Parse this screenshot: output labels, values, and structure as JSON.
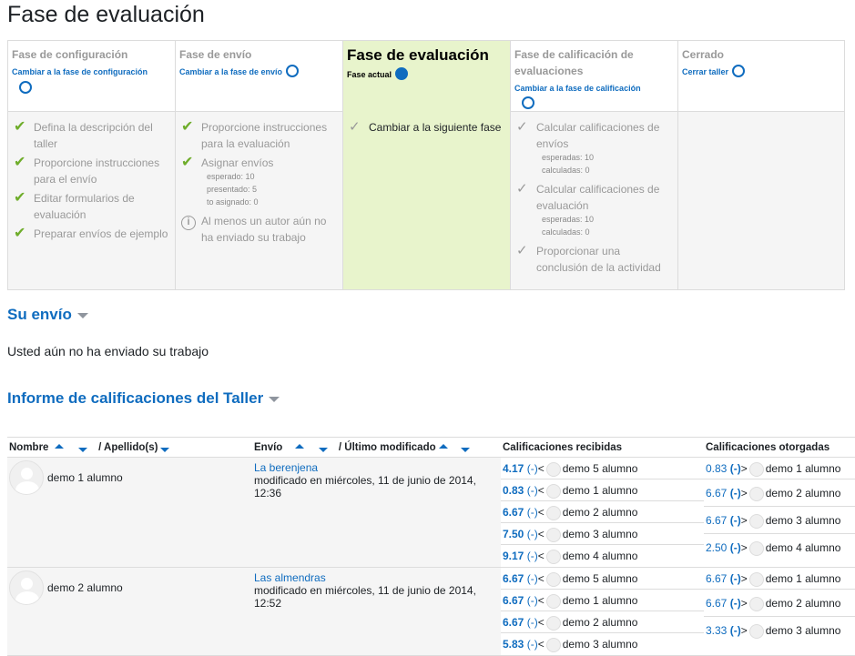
{
  "page_title": "Fase de evaluación",
  "phases": [
    {
      "title": "Fase de configuración",
      "link": "Cambiar a la fase de configuración",
      "tasks": [
        {
          "text": "Defina la descripción del taller",
          "status": "done"
        },
        {
          "text": "Proporcione instrucciones para el envío",
          "status": "done"
        },
        {
          "text": "Editar formularios de evaluación",
          "status": "done"
        },
        {
          "text": "Preparar envíos de ejemplo",
          "status": "done"
        }
      ]
    },
    {
      "title": "Fase de envío",
      "link": "Cambiar a la fase de envío",
      "tasks": [
        {
          "text": "Proporcione instrucciones para la evaluación",
          "status": "done"
        },
        {
          "text": "Asignar envíos",
          "status": "done",
          "details": [
            "esperado: 10",
            "presentado: 5",
            "to asignado: 0"
          ]
        },
        {
          "text": "Al menos un autor aún no ha enviado su trabajo",
          "status": "info"
        }
      ]
    },
    {
      "title": "Fase de evaluación",
      "current_label": "Fase actual",
      "tasks": [
        {
          "text": "Cambiar a la siguiente fase",
          "status": "todo"
        }
      ]
    },
    {
      "title": "Fase de calificación de evaluaciones",
      "link": "Cambiar a la fase de calificación",
      "tasks": [
        {
          "text": "Calcular calificaciones de envíos",
          "status": "todo",
          "details": [
            "esperadas: 10",
            "calculadas: 0"
          ]
        },
        {
          "text": "Calcular calificaciones de evaluación",
          "status": "todo",
          "details": [
            "esperadas: 10",
            "calculadas: 0"
          ]
        },
        {
          "text": "Proporcionar una conclusión de la actividad",
          "status": "todo"
        }
      ]
    },
    {
      "title": "Cerrado",
      "link": "Cerrar taller",
      "tasks": []
    }
  ],
  "your_submission": {
    "title": "Su envío",
    "message": "Usted aún no ha enviado su trabajo"
  },
  "report": {
    "title": "Informe de calificaciones del Taller",
    "headers": {
      "first_name": "Nombre",
      "last_name": "/ Apellido(s)",
      "submission": "Envío",
      "last_modified": "/ Último modificado",
      "received": "Calificaciones recibidas",
      "given": "Calificaciones otorgadas"
    },
    "rows": [
      {
        "name": "demo 1 alumno",
        "submission_title": "La berenjena",
        "submission_modified": "modificado en miércoles, 11 de junio de 2014, 12:36",
        "received": [
          {
            "grade": "4.17",
            "paren": "(-)",
            "arrow": "<",
            "who": "demo 5 alumno"
          },
          {
            "grade": "0.83",
            "paren": "(-)",
            "arrow": "<",
            "who": "demo 1 alumno"
          },
          {
            "grade": "6.67",
            "paren": "(-)",
            "arrow": "<",
            "who": "demo 2 alumno"
          },
          {
            "grade": "7.50",
            "paren": "(-)",
            "arrow": "<",
            "who": "demo 3 alumno"
          },
          {
            "grade": "9.17",
            "paren": "(-)",
            "arrow": "<",
            "who": "demo 4 alumno"
          }
        ],
        "given": [
          {
            "grade": "0.83",
            "paren": "(-)",
            "arrow": ">",
            "who": "demo 1 alumno"
          },
          {
            "grade": "6.67",
            "paren": "(-)",
            "arrow": ">",
            "who": "demo 2 alumno"
          },
          {
            "grade": "6.67",
            "paren": "(-)",
            "arrow": ">",
            "who": "demo 3 alumno"
          },
          {
            "grade": "2.50",
            "paren": "(-)",
            "arrow": ">",
            "who": "demo 4 alumno"
          }
        ]
      },
      {
        "name": "demo 2 alumno",
        "submission_title": "Las almendras",
        "submission_modified": "modificado en miércoles, 11 de junio de 2014, 12:52",
        "received": [
          {
            "grade": "6.67",
            "paren": "(-)",
            "arrow": "<",
            "who": "demo 5 alumno"
          },
          {
            "grade": "6.67",
            "paren": "(-)",
            "arrow": "<",
            "who": "demo 1 alumno"
          },
          {
            "grade": "6.67",
            "paren": "(-)",
            "arrow": "<",
            "who": "demo 2 alumno"
          },
          {
            "grade": "5.83",
            "paren": "(-)",
            "arrow": "<",
            "who": "demo 3 alumno"
          }
        ],
        "given": [
          {
            "grade": "6.67",
            "paren": "(-)",
            "arrow": ">",
            "who": "demo 1 alumno"
          },
          {
            "grade": "6.67",
            "paren": "(-)",
            "arrow": ">",
            "who": "demo 2 alumno"
          },
          {
            "grade": "3.33",
            "paren": "(-)",
            "arrow": ">",
            "who": "demo 3 alumno"
          }
        ]
      }
    ]
  },
  "colors": {
    "link": "#0f6cbf",
    "active_phase_bg": "#e8f4cc",
    "done_check": "#6fad2b",
    "muted": "#999999"
  },
  "icons": {
    "done": "check-icon",
    "todo": "unchecked-check-icon",
    "info": "info-icon",
    "phase": "phase-circle-icon"
  }
}
